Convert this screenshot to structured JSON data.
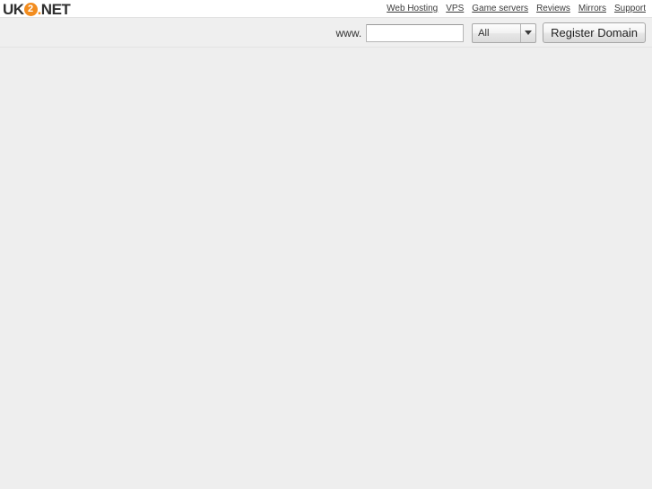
{
  "logo": {
    "prefix": "UK",
    "badge": "2",
    "dot": ".",
    "suffix": "NET",
    "alt": "UK2.NET",
    "accent_color": "#f28c1e",
    "text_color": "#2f2f2f"
  },
  "nav": {
    "items": [
      {
        "label": "Web Hosting",
        "name": "nav-web-hosting"
      },
      {
        "label": "VPS",
        "name": "nav-vps"
      },
      {
        "label": "Game servers",
        "name": "nav-game-servers"
      },
      {
        "label": "Reviews",
        "name": "nav-reviews"
      },
      {
        "label": "Mirrors",
        "name": "nav-mirrors"
      },
      {
        "label": "Support",
        "name": "nav-support"
      }
    ]
  },
  "search": {
    "prefix_label": "www.",
    "input_value": "",
    "input_placeholder": "",
    "tld_selected": "All",
    "tld_options": [
      "All"
    ],
    "submit_label": "Register Domain"
  },
  "page": {
    "background_color": "#eeeeee",
    "header_background_color": "#ffffff",
    "search_band_background_color": "#efefef",
    "content": ""
  }
}
